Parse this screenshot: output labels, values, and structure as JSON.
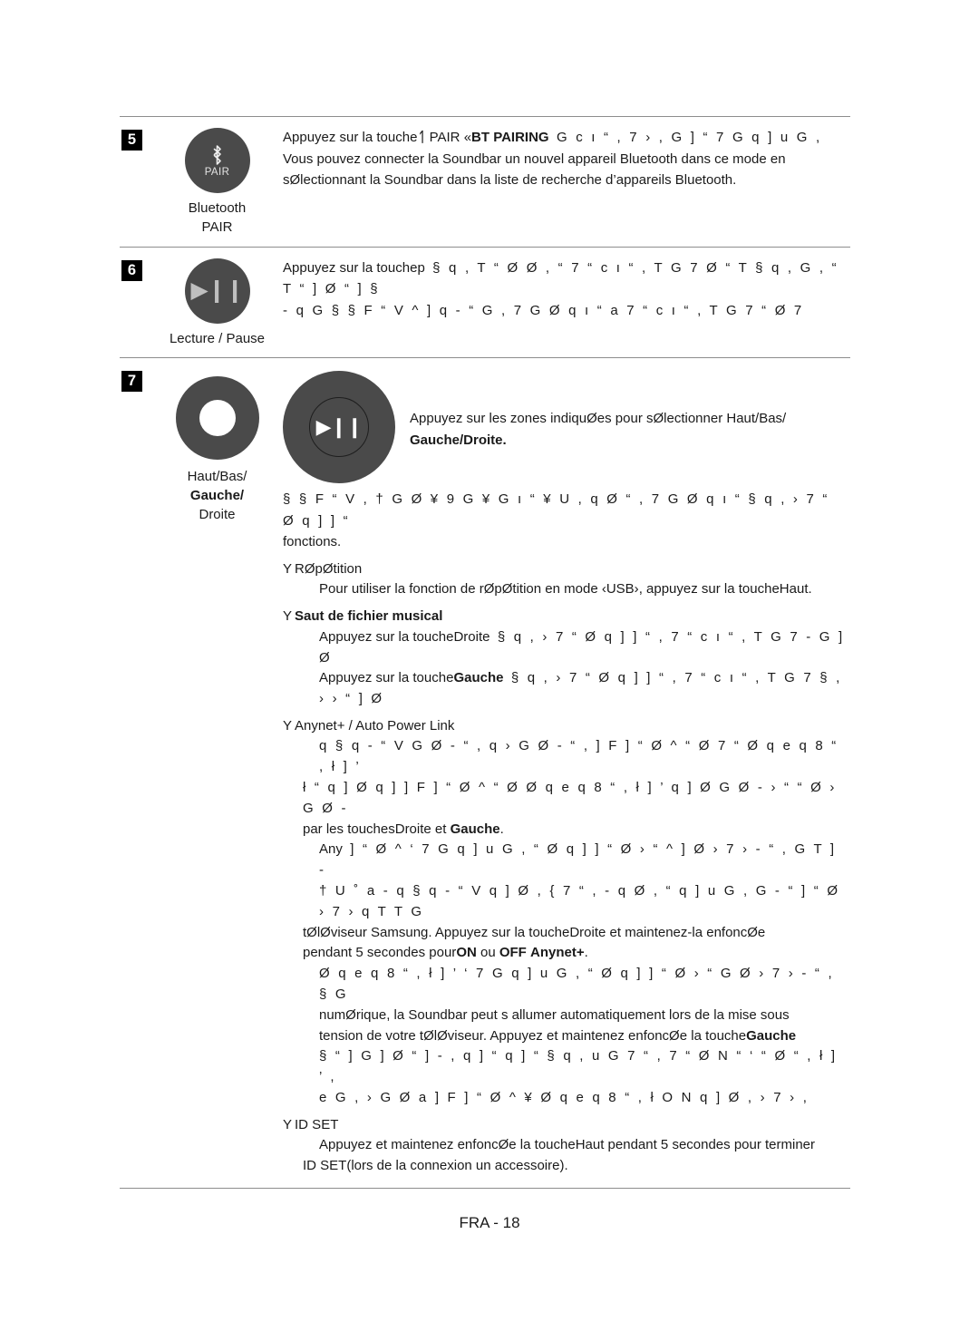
{
  "document": {
    "footer_page_label": "FRA - 18"
  },
  "colors": {
    "button_gray": "#4a4a4a",
    "rule_gray": "#8d8d8d",
    "badge_black": "#000000"
  },
  "table": {
    "rows": [
      {
        "step_number": "5",
        "icon": {
          "type": "bluetooth-pair-button",
          "inner_label": "PAIR"
        },
        "caption_lines": [
          {
            "text": "Bluetooth",
            "bold": false
          },
          {
            "text": "PAIR",
            "bold": false
          }
        ],
        "description_lines": [
          {
            "segments": [
              {
                "text": "Appuyez sur la touche",
                "style": "normal"
              },
              {
                "text": "ᛐ",
                "style": "bt-icon"
              },
              {
                "text": " PAIR ",
                "style": "normal"
              },
              {
                "text": "«",
                "style": "normal"
              },
              {
                "text": "BT PAIRING",
                "style": "bold"
              },
              {
                "text": "    G c ı “    , 7 › , G ]   “ 7 G   q ] u G ,",
                "style": "garble"
              }
            ]
          },
          {
            "segments": [
              {
                "text": "Vous pouvez connecter la Soundbar   un nouvel appareil Bluetooth dans ce mode en",
                "style": "normal"
              }
            ]
          },
          {
            "segments": [
              {
                "text": "sØlectionnant la Soundbar dans la liste de recherche d’appareils Bluetooth.",
                "style": "normal"
              }
            ]
          }
        ]
      },
      {
        "step_number": "6",
        "icon": {
          "type": "play-pause-button",
          "inner_label": ""
        },
        "caption_lines": [
          {
            "text": "Lecture / Pause",
            "bold": false
          }
        ],
        "description_lines": [
          {
            "segments": [
              {
                "text": "Appuyez sur la touche",
                "style": "normal"
              },
              {
                "text": "p",
                "style": "normal"
              },
              {
                "text": "   § q  ,  T “ Ø Ø , “  7 “  c ı “ ,  T      G 7 Ø “ T § q , G  , “ T “ ] Ø  “ ]  §",
                "style": "garble"
              }
            ]
          },
          {
            "segments": [
              {
                "text": " - q     G § §  F “ V  ^  ] q  - “ G     ,  7 G  Ø q   ı “ a 7 “  c ı “ ,  T      G 7 “  Ø  7",
                "style": "garble"
              }
            ]
          }
        ]
      },
      {
        "step_number": "7",
        "icon": {
          "type": "ring-direction-pad",
          "inner_label": ""
        },
        "caption_lines": [
          {
            "text": "Haut/Bas/",
            "bold": false
          },
          {
            "text": "Gauche/",
            "bold": true
          },
          {
            "text": "Droite",
            "bold": false
          }
        ],
        "dial_icon": {
          "type": "dial-play-pause",
          "glyph": "▶❙❙"
        },
        "dial_text_lines": [
          {
            "text": "Appuyez sur les zones indiquØes pour sØlectionner Haut/Bas/",
            "bold": false
          },
          {
            "text": "Gauche/Droite.",
            "bold": true
          }
        ],
        "body": [
          {
            "kind": "paragraph",
            "indent": 0,
            "lines": [
              {
                "segments": [
                  {
                    "text": " § §  F “ V    ,  † G  Ø ¥ 9 G  ¥  G   ı “ ¥ U , q  Ø “    ,  7 G  Ø q   ı “  § q  ,  › 7 “  Ø  q ] ] “",
                    "style": "garble"
                  }
                ]
              },
              {
                "segments": [
                  {
                    "text": "fonctions.",
                    "style": "normal"
                  }
                ]
              }
            ]
          },
          {
            "kind": "bullet",
            "bullet_glyph": "Y",
            "label": "RØpØtition",
            "label_bold": false,
            "lines": [
              {
                "indent": 1,
                "segments": [
                  {
                    "text": "Pour utiliser la fonction de rØpØtition en mode ",
                    "style": "normal"
                  },
                  {
                    "text": "‹USB›",
                    "style": "normal"
                  },
                  {
                    "text": ", appuyez sur la touche",
                    "style": "normal"
                  },
                  {
                    "text": "Haut",
                    "style": "normal"
                  },
                  {
                    "text": ".",
                    "style": "normal"
                  }
                ]
              }
            ]
          },
          {
            "kind": "bullet",
            "bullet_glyph": "Y",
            "label": "Saut de fichier musical",
            "label_bold": true,
            "lines": [
              {
                "indent": 1,
                "segments": [
                  {
                    "text": "Appuyez sur la touche",
                    "style": "normal"
                  },
                  {
                    "text": "Droite",
                    "style": "normal"
                  },
                  {
                    "text": "   § q  ,   › 7 “  Ø  q ] ] “ , 7 “  c ı “ ,  T      G 7      - G ] Ø",
                    "style": "garble"
                  }
                ]
              },
              {
                "indent": 1,
                "segments": [
                  {
                    "text": "Appuyez sur la touche",
                    "style": "normal"
                  },
                  {
                    "text": "Gauche",
                    "style": "bold"
                  },
                  {
                    "text": "   § q  ,   › 7 “  Ø  q ] ] “ , 7 “  c ı “ ,  T      G 7 § , ›  ›  “ ] Ø",
                    "style": "garble"
                  }
                ]
              }
            ]
          },
          {
            "kind": "bullet",
            "bullet_glyph": "Y",
            "label": "Anynet+ / Auto Power Link",
            "label_bold": false,
            "lines": [
              {
                "indent": 1,
                "segments": [
                  {
                    "text": " q    § q  - “ V  G  Ø  - “ , q   ›  G  Ø  - “ ,  ] F ] “ Ø ^  “ Ø  7 “    Ø q  e q 8 “ ,  ł ] ’",
                    "style": "garble"
                  }
                ]
              },
              {
                "indent": 0,
                "segments": [
                  {
                    "text": "ł “    q ]  Ø  q ]    ] F ] “ Ø ^  “ Ø    Ø q  e q 8 “ ,  ł ] ’  q ] Ø  G  Ø  - › “   “ Ø  ›  G  Ø -",
                    "style": "garble"
                  }
                ]
              },
              {
                "indent": 0,
                "segments": [
                  {
                    "text": "par les touches",
                    "style": "normal"
                  },
                  {
                    "text": "Droite",
                    "style": "normal"
                  },
                  {
                    "text": " et ",
                    "style": "normal"
                  },
                  {
                    "text": "Gauche",
                    "style": "bold"
                  },
                  {
                    "text": ".",
                    "style": "normal"
                  }
                ]
              },
              {
                "indent": 1,
                "segments": [
                  {
                    "text": "Any",
                    "style": "normal"
                  },
                  {
                    "text": " ] “ Ø ^  ‘     7 G   q ] u G , “  Ø   q ] ] “  Ø › “ ^   ]  Ø › 7 › -   “ ,  G T  ]   -",
                    "style": "garble"
                  }
                ]
              },
              {
                "indent": 1,
                "segments": [
                  {
                    "text": "† U  ˚ a  - q    § q  - “ V  q ] Ø , { 7 “ ,  - q Ø , “   q ] u G , G - “   ] “ Ø › 7 ›  q T T G",
                    "style": "garble"
                  }
                ]
              },
              {
                "indent": 0,
                "segments": [
                  {
                    "text": "tØlØviseur Samsung. Appuyez sur la touche",
                    "style": "normal"
                  },
                  {
                    "text": "Droite",
                    "style": "normal"
                  },
                  {
                    "text": " et maintenez-la enfoncØe",
                    "style": "normal"
                  }
                ]
              },
              {
                "indent": 0,
                "segments": [
                  {
                    "text": "pendant 5 secondes pour",
                    "style": "normal"
                  },
                  {
                    "text": "ON",
                    "style": "bold"
                  },
                  {
                    "text": " ou ",
                    "style": "normal"
                  },
                  {
                    "text": "OFF",
                    "style": "bold"
                  },
                  {
                    "text": " ",
                    "style": "normal"
                  },
                  {
                    "text": "Anynet+",
                    "style": "bold"
                  },
                  {
                    "text": ".",
                    "style": "normal"
                  }
                ]
              },
              {
                "indent": 1,
                "segments": [
                  {
                    "text": " Ø q  e q 8 “ ,  ł ] ’  ‘    7 G   q ] u G , “  Ø   q ] ] “  Ø › “  G   Ø › 7 › -    “ , § G",
                    "style": "garble"
                  }
                ]
              },
              {
                "indent": 1,
                "segments": [
                  {
                    "text": "numØrique, la Soundbar peut s allumer automatiquement lors de la mise sous",
                    "style": "normal"
                  }
                ]
              },
              {
                "indent": 1,
                "segments": [
                  {
                    "text": "tension de votre tØlØviseur. Appuyez et maintenez enfoncØe la touche",
                    "style": "normal"
                  },
                  {
                    "text": "Gauche",
                    "style": "bold"
                  }
                ]
              },
              {
                "indent": 1,
                "segments": [
                  {
                    "text": " § “ ]  G ] Ø  “ ] -  , q ]     “  q ]  “   § q  ,  u G    7 “ , 7 “    Ø N “ ‘ “ Ø “ , ł ] ’   ,",
                    "style": "garble"
                  }
                ]
              },
              {
                "indent": 1,
                "segments": [
                  {
                    "text": " e G ,  ›  G  Ø a  ] F ] “ Ø ^ ¥    Ø q  e q 8 “ ,  ł O N  q ] Ø  , ›  7 ›      ,",
                    "style": "garble"
                  }
                ]
              }
            ]
          },
          {
            "kind": "bullet",
            "bullet_glyph": "Y",
            "label": "ID SET",
            "label_bold": false,
            "lines": [
              {
                "indent": 1,
                "segments": [
                  {
                    "text": "Appuyez et maintenez enfoncØe la touche",
                    "style": "normal"
                  },
                  {
                    "text": "Haut",
                    "style": "normal"
                  },
                  {
                    "text": " pendant 5 secondes pour terminer",
                    "style": "normal"
                  }
                ]
              },
              {
                "indent": 0,
                "segments": [
                  {
                    "text": "ID SET",
                    "style": "normal"
                  },
                  {
                    "text": "(lors de la connexion   un accessoire).",
                    "style": "normal"
                  }
                ]
              }
            ]
          }
        ]
      }
    ]
  }
}
